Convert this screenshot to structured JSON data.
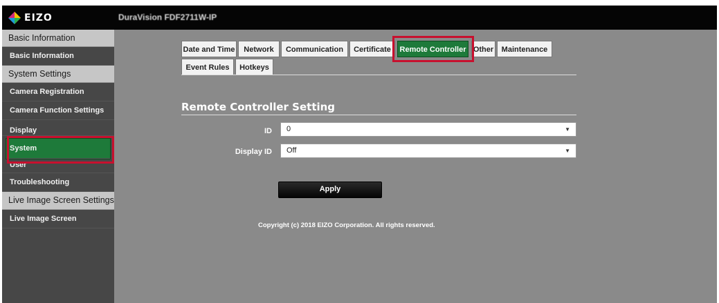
{
  "header": {
    "logo_text": "EIZO",
    "product_name": "DuraVision FDF2711W-IP"
  },
  "sidebar": {
    "basic_section": "Basic Information",
    "basic_items": [
      "Basic Information"
    ],
    "system_section": "System Settings",
    "system_items": [
      "Camera Registration",
      "Camera Function Settings",
      "Display",
      "System",
      "User",
      "Troubleshooting"
    ],
    "live_section": "Live Image Screen Settings",
    "live_items": [
      "Live Image Screen"
    ],
    "active_item": "System"
  },
  "tabs": [
    "Date and Time",
    "Network",
    "Communication",
    "Certificate",
    "Remote Controller",
    "Other",
    "Maintenance",
    "Event Rules",
    "Hotkeys"
  ],
  "active_tab": "Remote Controller",
  "section_title": "Remote Controller Setting",
  "fields": {
    "id": {
      "label": "ID",
      "value": "0"
    },
    "display_id": {
      "label": "Display ID",
      "value": "Off"
    }
  },
  "apply_label": "Apply",
  "copyright": "Copyright (c) 2018 EIZO Corporation. All rights reserved.",
  "colors": {
    "accent_green": "#1e7a3a",
    "highlight_red": "#c8102e",
    "content_bg": "#8a8a8a",
    "sidebar_bg": "#474747"
  }
}
